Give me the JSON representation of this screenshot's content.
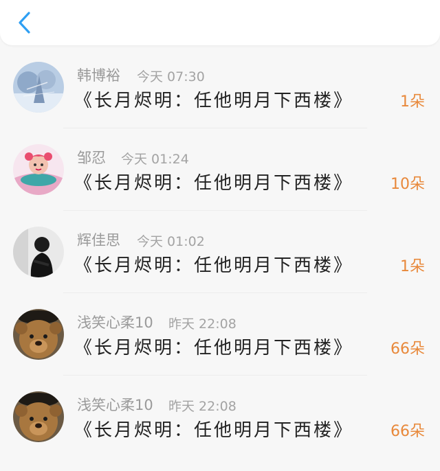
{
  "header": {
    "back_icon": "chevron-left-icon",
    "accent": "#2e9ff3"
  },
  "items": [
    {
      "name": "韩博裕",
      "time": "今天 07:30",
      "title": "《长月烬明：任他明月下西楼》",
      "count": "1朵",
      "avatar": "winter-tree-avatar"
    },
    {
      "name": "邹忍",
      "time": "今天 01:24",
      "title": "《长月烬明：任他明月下西楼》",
      "count": "10朵",
      "avatar": "cartoon-girl-avatar"
    },
    {
      "name": "辉佳思",
      "time": "今天 01:02",
      "title": "《长月烬明：任他明月下西楼》",
      "count": "1朵",
      "avatar": "silhouette-avatar"
    },
    {
      "name": "浅笑心柔10",
      "time": "昨天 22:08",
      "title": "《长月烬明：任他明月下西楼》",
      "count": "66朵",
      "avatar": "teddy-bear-avatar"
    },
    {
      "name": "浅笑心柔10",
      "time": "昨天 22:08",
      "title": "《长月烬明：任他明月下西楼》",
      "count": "66朵",
      "avatar": "teddy-bear-avatar"
    }
  ],
  "colors": {
    "name": "#9a9a9a",
    "title": "#222222",
    "count": "#e8883a",
    "background": "#f7f7f7"
  }
}
